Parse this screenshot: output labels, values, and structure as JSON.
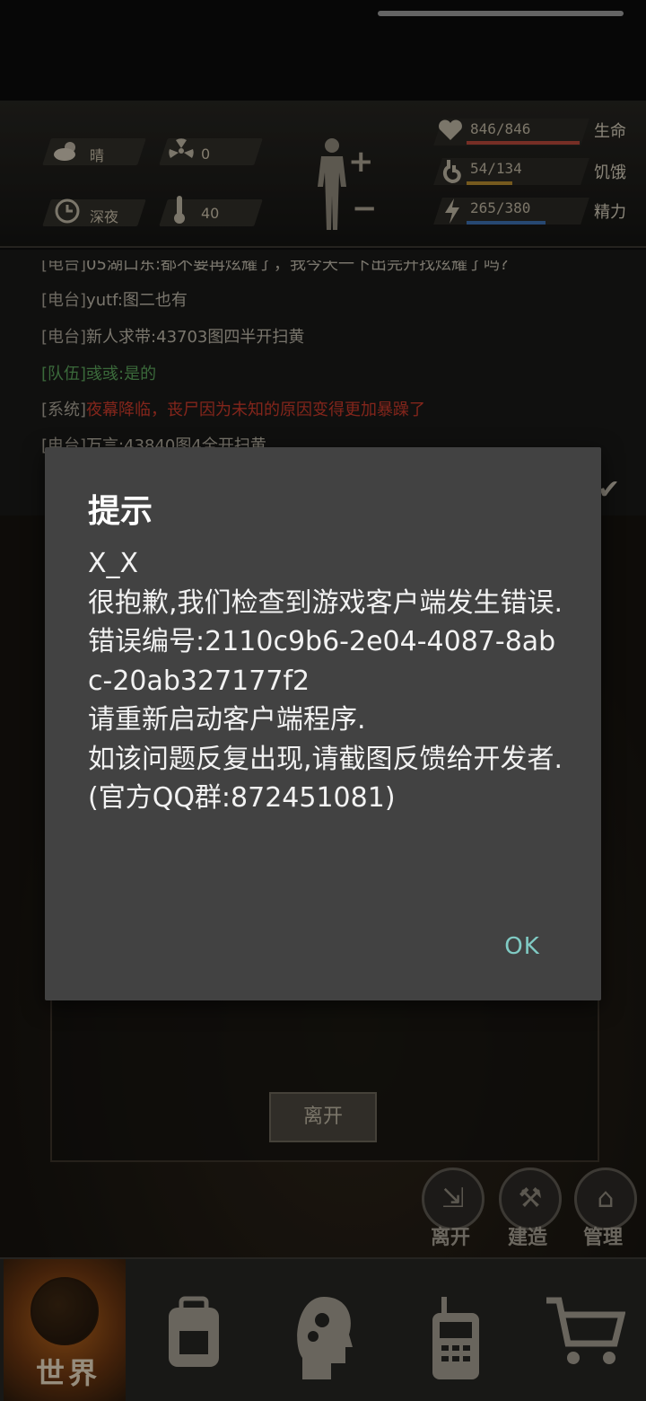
{
  "hud": {
    "weather": "晴",
    "radiation": "0",
    "time_of_day": "深夜",
    "temperature": "40",
    "stats": [
      {
        "value": "846/846",
        "name": "生命",
        "fill": 1.0,
        "color": "#b5483a"
      },
      {
        "value": "54/134",
        "name": "饥饿",
        "fill": 0.403,
        "color": "#b58a2e"
      },
      {
        "value": "265/380",
        "name": "精力",
        "fill": 0.697,
        "color": "#3c6fb0"
      }
    ],
    "icons": {
      "weather": "cloud-sun-icon",
      "radiation": "radiation-icon",
      "time": "clock-icon",
      "temperature": "thermometer-icon",
      "body": "body-figure-icon",
      "health": "heart-icon",
      "hunger": "stomach-icon",
      "energy": "lightning-icon"
    }
  },
  "chat": {
    "lines": [
      {
        "tag": "[电台]",
        "text": "05湖口东:都不要再炫耀了，我今天一下出完开找炫耀了吗?",
        "kind": "radio"
      },
      {
        "tag": "[电台]",
        "text": "yutf:图二也有",
        "kind": "radio"
      },
      {
        "tag": "[电台]",
        "text": "新人求带:43703图四半开扫黄",
        "kind": "radio"
      },
      {
        "tag": "[队伍]",
        "text": "彧彧:是的",
        "kind": "team"
      },
      {
        "tag": "[系统]",
        "text": "夜幕降临，丧尸因为未知的原因变得更加暴躁了",
        "kind": "system"
      },
      {
        "tag": "[电台]",
        "text": "万言:43840图4全开扫黄",
        "kind": "radio"
      }
    ]
  },
  "scene": {
    "leave_button": "离开",
    "actions": [
      {
        "label": "离开",
        "icon": "exit-person-icon"
      },
      {
        "label": "建造",
        "icon": "hammer-icon"
      },
      {
        "label": "管理",
        "icon": "house-gear-icon"
      }
    ]
  },
  "bottom_nav": {
    "world_label": "世界",
    "tabs": [
      {
        "name": "backpack",
        "icon": "backpack-icon"
      },
      {
        "name": "skills",
        "icon": "head-gears-icon"
      },
      {
        "name": "radio",
        "icon": "walkie-talkie-icon"
      },
      {
        "name": "shop",
        "icon": "shopping-cart-icon"
      }
    ]
  },
  "dialog": {
    "title": "提示",
    "message": "X_X\n很抱歉,我们检查到游戏客户端发生错误.\n错误编号:2110c9b6-2e04-4087-8abc-20ab327177f2\n请重新启动客户端程序.\n如该问题反复出现,请截图反馈给开发者.\n(官方QQ群:872451081)",
    "ok_label": "OK"
  }
}
